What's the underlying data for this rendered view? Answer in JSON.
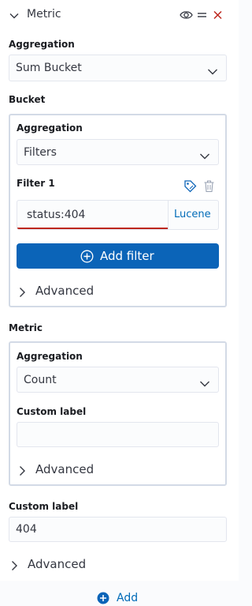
{
  "metric_panel": {
    "title": "Metric",
    "aggregation_label": "Aggregation",
    "aggregation_value": "Sum Bucket",
    "bucket_label": "Bucket",
    "bucket": {
      "aggregation_label": "Aggregation",
      "aggregation_value": "Filters",
      "filter_label": "Filter 1",
      "filter_query": "status:404",
      "query_language": "Lucene",
      "add_filter_label": "Add filter",
      "advanced_label": "Advanced"
    },
    "metric_label": "Metric",
    "metric": {
      "aggregation_label": "Aggregation",
      "aggregation_value": "Count",
      "custom_label_label": "Custom label",
      "custom_label_value": "",
      "advanced_label": "Advanced"
    },
    "custom_label_label": "Custom label",
    "custom_label_value": "404",
    "advanced_label": "Advanced"
  },
  "footer": {
    "add_label": "Add"
  },
  "colors": {
    "accent": "#0b64b8",
    "link": "#006bb8",
    "danger": "#bd271e"
  },
  "icons": {
    "collapse": "chevron-down-icon",
    "toggle_visibility": "eye-icon",
    "drag": "drag-handle-icon",
    "remove": "close-icon",
    "label_filter": "tag-icon",
    "delete_filter": "trash-icon",
    "add": "plus-circle-icon"
  }
}
